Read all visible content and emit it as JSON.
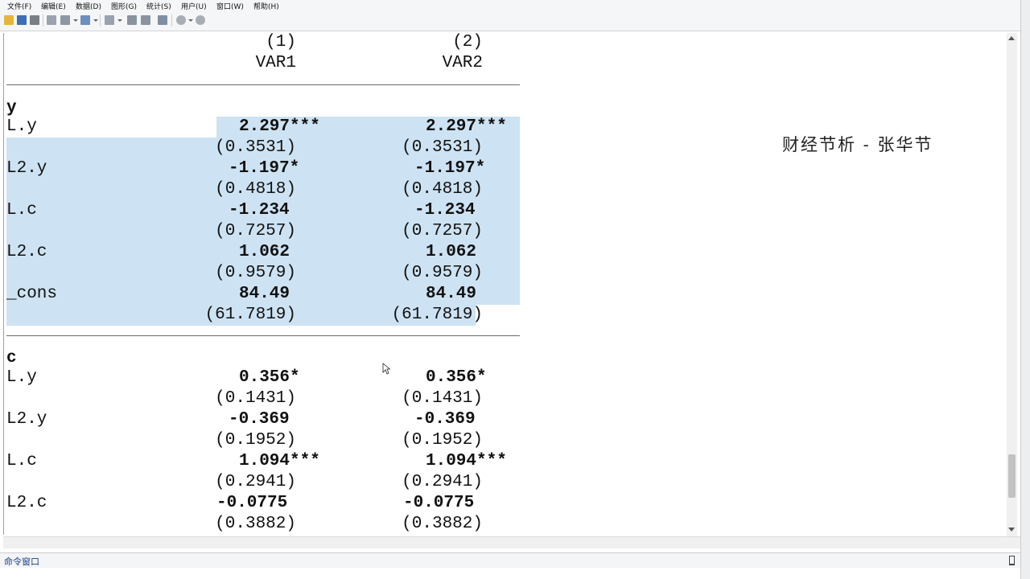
{
  "menu": [
    "文件(F)",
    "编辑(E)",
    "数据(D)",
    "图形(G)",
    "统计(S)",
    "用户(U)",
    "窗口(W)",
    "帮助(H)"
  ],
  "table": {
    "col_numbers": [
      "(1)",
      "(2)"
    ],
    "col_names": [
      "VAR1",
      "VAR2"
    ],
    "eq1": "y",
    "eq2": "c",
    "rows": [
      {
        "label": "L.y",
        "v1": "2.297***",
        "se1": "(0.3531)",
        "v2": "2.297***",
        "se2": "(0.3531)"
      },
      {
        "label": "L2.y",
        "v1": "-1.197*",
        "se1": "(0.4818)",
        "v2": "-1.197*",
        "se2": "(0.4818)"
      },
      {
        "label": "L.c",
        "v1": "-1.234",
        "se1": "(0.7257)",
        "v2": "-1.234",
        "se2": "(0.7257)"
      },
      {
        "label": "L2.c",
        "v1": "1.062",
        "se1": "(0.9579)",
        "v2": "1.062",
        "se2": "(0.9579)"
      },
      {
        "label": "_cons",
        "v1": "84.49",
        "se1": "(61.7819)",
        "v2": "84.49",
        "se2": "(61.7819)"
      },
      {
        "label": "L.y",
        "v1": "0.356*",
        "se1": "(0.1431)",
        "v2": "0.356*",
        "se2": "(0.1431)"
      },
      {
        "label": "L2.y",
        "v1": "-0.369",
        "se1": "(0.1952)",
        "v2": "-0.369",
        "se2": "(0.1952)"
      },
      {
        "label": "L.c",
        "v1": "1.094***",
        "se1": "(0.2941)",
        "v2": "1.094***",
        "se2": "(0.2941)"
      },
      {
        "label": "L2.c",
        "v1": "-0.0775",
        "se1": "(0.3882)",
        "v2": "-0.0775",
        "se2": "(0.3882)"
      }
    ]
  },
  "watermark": "财经节析 - 张华节",
  "command_window": {
    "title": "命令窗口"
  },
  "colors": {
    "selection": "#cde3f3",
    "title_blue": "#1a3f8c"
  },
  "icons": [
    "open-icon",
    "save-icon",
    "print-icon",
    "log-icon",
    "viewer-icon",
    "graph-icon",
    "do-file-editor-icon",
    "data-editor-icon",
    "data-browser-icon",
    "variables-manager-icon",
    "more-icon",
    "break-icon",
    "pin-icon"
  ]
}
